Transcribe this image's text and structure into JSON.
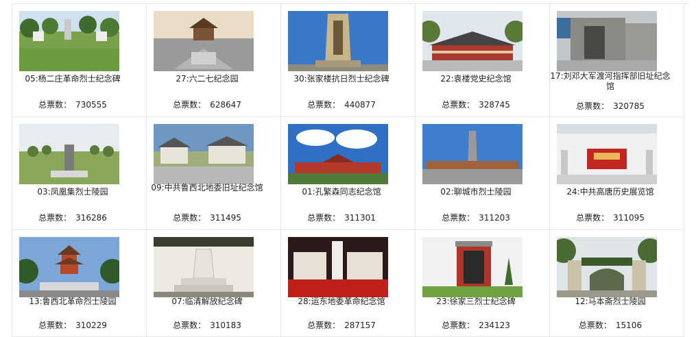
{
  "memorials": [
    {
      "name": "05:杨二庄革命烈士纪念碑",
      "votes": "730555",
      "photo": "stele-garden-icon"
    },
    {
      "name": "27:六二七纪念园",
      "votes": "628647",
      "photo": "pavilion-book-icon"
    },
    {
      "name": "30:张家楼抗日烈士纪念碑",
      "votes": "440877",
      "photo": "tall-monument-icon"
    },
    {
      "name": "22:袁楼党史纪念馆",
      "votes": "328745",
      "photo": "hall-building-icon"
    },
    {
      "name": "17:刘邓大军渡河指挥部旧址纪念馆",
      "votes": "320785",
      "photo": "old-courtyard-icon"
    },
    {
      "name": "03:凤凰集烈士陵园",
      "votes": "316286",
      "photo": "grave-stone-icon"
    },
    {
      "name": "09:中共鲁西北地委旧址纪念馆",
      "votes": "311495",
      "photo": "village-houses-icon"
    },
    {
      "name": "01:孔繁森同志纪念馆",
      "votes": "311301",
      "photo": "cloud-hall-icon"
    },
    {
      "name": "02:聊城市烈士陵园",
      "votes": "311203",
      "photo": "obelisk-plaza-icon"
    },
    {
      "name": "24:中共高唐历史展览馆",
      "votes": "311095",
      "photo": "exhibition-interior-icon"
    },
    {
      "name": "13:鲁西北革命烈士陵园",
      "votes": "310229",
      "photo": "pagoda-icon"
    },
    {
      "name": "07:临清解放纪念碑",
      "votes": "310183",
      "photo": "white-monument-icon"
    },
    {
      "name": "28:运东地委革命纪念馆",
      "votes": "287157",
      "photo": "red-exhibition-icon"
    },
    {
      "name": "23:徐家三烈士纪念碑",
      "votes": "234123",
      "photo": "red-wall-stele-icon"
    },
    {
      "name": "12:马本斋烈士陵园",
      "votes": "15106",
      "photo": "arch-gate-icon"
    }
  ],
  "vote_label": "总票数："
}
